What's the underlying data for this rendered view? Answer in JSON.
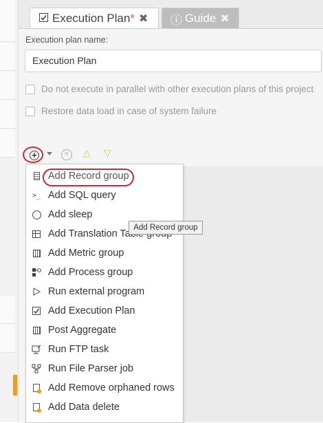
{
  "tabs": {
    "active": {
      "label": "Execution Plan",
      "modified_marker": "*",
      "close": "✖"
    },
    "guide": {
      "label": "Guide",
      "info_icon": "ⓘ",
      "close": "✖"
    }
  },
  "form": {
    "name_label": "Execution plan name:",
    "name_value": "Execution Plan",
    "option_parallel": "Do not execute in parallel with other execution plans of this project",
    "option_restore": "Restore data load in case of system failure"
  },
  "toolbar": {
    "add_symbol": "+",
    "remove_symbol": "×",
    "up_symbol": "△",
    "down_symbol": "▽"
  },
  "menu": {
    "items": [
      {
        "label": "Add Record group",
        "icon": "record-group-icon"
      },
      {
        "label": "Add SQL query",
        "icon": "sql-prompt-icon"
      },
      {
        "label": "Add sleep",
        "icon": "clock-icon"
      },
      {
        "label": "Add Translation Table group",
        "icon": "table-icon"
      },
      {
        "label": "Add Metric group",
        "icon": "metric-grid-icon"
      },
      {
        "label": "Add Process group",
        "icon": "process-icon"
      },
      {
        "label": "Run external program",
        "icon": "play-triangle-icon"
      },
      {
        "label": "Add Execution Plan",
        "icon": "checkbox-icon"
      },
      {
        "label": "Post Aggregate",
        "icon": "aggregate-grid-icon"
      },
      {
        "label": "Run FTP task",
        "icon": "ftp-icon"
      },
      {
        "label": "Run File Parser job",
        "icon": "file-parser-icon"
      },
      {
        "label": "Add Remove orphaned rows",
        "icon": "orphaned-rows-icon"
      },
      {
        "label": "Add Data delete",
        "icon": "data-delete-icon"
      }
    ]
  },
  "tooltip": "Add Record group",
  "colors": {
    "highlight_red": "#d9262c",
    "accent_orange": "#f39c12",
    "arrow_green": "#b9d26a"
  }
}
